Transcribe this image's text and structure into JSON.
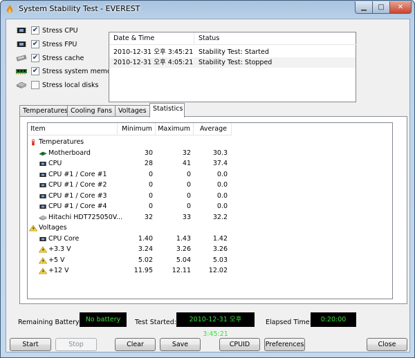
{
  "window": {
    "title": "System Stability Test - EVEREST"
  },
  "checks": [
    {
      "label": "Stress CPU",
      "checked": true,
      "icon": "cpu-chip-icon"
    },
    {
      "label": "Stress FPU",
      "checked": true,
      "icon": "fpu-chip-icon"
    },
    {
      "label": "Stress cache",
      "checked": true,
      "icon": "cache-icon"
    },
    {
      "label": "Stress system memory",
      "checked": true,
      "icon": "memory-module-icon"
    },
    {
      "label": "Stress local disks",
      "checked": false,
      "icon": "hard-disk-icon"
    }
  ],
  "log": {
    "headers": [
      "Date & Time",
      "Status"
    ],
    "rows": [
      {
        "time": "2010-12-31 오후 3:45:21",
        "status": "Stability Test: Started"
      },
      {
        "time": "2010-12-31 오후 4:05:21",
        "status": "Stability Test: Stopped"
      }
    ]
  },
  "tabs": [
    "Temperatures",
    "Cooling Fans",
    "Voltages",
    "Statistics"
  ],
  "active_tab": "Statistics",
  "stats": {
    "headers": [
      "Item",
      "Minimum",
      "Maximum",
      "Average"
    ],
    "rows": [
      {
        "kind": "group",
        "name": "Temperatures",
        "icon": "thermometer-icon"
      },
      {
        "kind": "item",
        "name": "Motherboard",
        "min": "30",
        "max": "32",
        "avg": "30.3",
        "icon": "motherboard-icon"
      },
      {
        "kind": "item",
        "name": "CPU",
        "min": "28",
        "max": "41",
        "avg": "37.4",
        "icon": "cpu-chip-icon"
      },
      {
        "kind": "item",
        "name": "CPU #1 / Core #1",
        "min": "0",
        "max": "0",
        "avg": "0.0",
        "icon": "cpu-chip-icon"
      },
      {
        "kind": "item",
        "name": "CPU #1 / Core #2",
        "min": "0",
        "max": "0",
        "avg": "0.0",
        "icon": "cpu-chip-icon"
      },
      {
        "kind": "item",
        "name": "CPU #1 / Core #3",
        "min": "0",
        "max": "0",
        "avg": "0.0",
        "icon": "cpu-chip-icon"
      },
      {
        "kind": "item",
        "name": "CPU #1 / Core #4",
        "min": "0",
        "max": "0",
        "avg": "0.0",
        "icon": "cpu-chip-icon"
      },
      {
        "kind": "item",
        "name": "Hitachi HDT725050V...",
        "min": "32",
        "max": "33",
        "avg": "32.2",
        "icon": "hard-disk-icon"
      },
      {
        "kind": "group",
        "name": "Voltages",
        "icon": "voltage-warning-icon"
      },
      {
        "kind": "item",
        "name": "CPU Core",
        "min": "1.40",
        "max": "1.43",
        "avg": "1.42",
        "icon": "cpu-chip-icon"
      },
      {
        "kind": "item",
        "name": "+3.3 V",
        "min": "3.24",
        "max": "3.26",
        "avg": "3.26",
        "icon": "voltage-warning-icon"
      },
      {
        "kind": "item",
        "name": "+5 V",
        "min": "5.02",
        "max": "5.04",
        "avg": "5.03",
        "icon": "voltage-warning-icon"
      },
      {
        "kind": "item",
        "name": "+12 V",
        "min": "11.95",
        "max": "12.11",
        "avg": "12.02",
        "icon": "voltage-warning-icon"
      }
    ]
  },
  "status": {
    "battery_label": "Remaining Battery:",
    "battery_value": "No battery",
    "started_label": "Test Started:",
    "started_value": "2010-12-31 오후 3:45:21",
    "elapsed_label": "Elapsed Time:",
    "elapsed_value": "0:20:00"
  },
  "buttons": {
    "start": "Start",
    "stop": "Stop",
    "clear": "Clear",
    "save": "Save",
    "cpuid": "CPUID",
    "preferences": "Preferences",
    "close": "Close"
  },
  "colors": {
    "lcd_text": "#39e03b",
    "lcd_bg": "#000000"
  }
}
